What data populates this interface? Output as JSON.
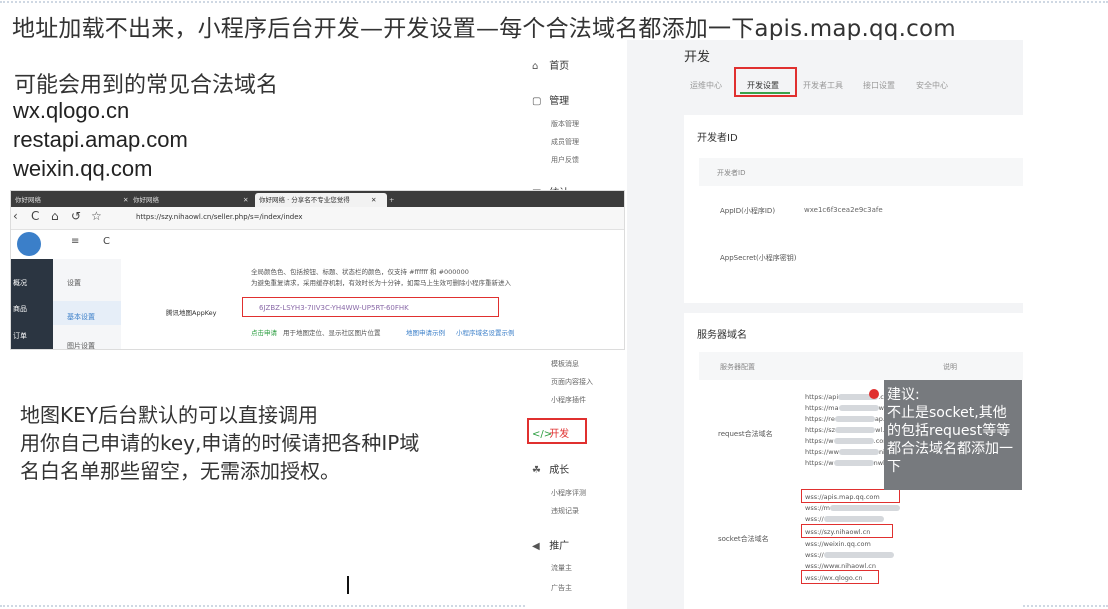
{
  "header": {
    "title": "地址加载不出来，小程序后台开发—开发设置—每个合法域名都添加一下apis.map.qq.com"
  },
  "tips": {
    "heading": "可能会用到的常见合法域名",
    "domains": [
      "wx.qlogo.cn",
      "restapi.amap.com",
      "weixin.qq.com"
    ]
  },
  "key_note": {
    "lines": [
      "地图KEY后台默认的可以直接调用",
      "用你自己申请的key,申请的时候请把各种IP域",
      "名白名单那些留空，无需添加授权。"
    ]
  },
  "advice": {
    "title": "建议:",
    "body": "不止是socket,其他的包括request等等都合法域名都添加一下"
  },
  "wx_admin": {
    "nav": [
      {
        "icon": "⌂",
        "label": "首页"
      },
      {
        "icon": "▢",
        "label": "管理"
      },
      {
        "icon": "▤",
        "label": "统计"
      },
      {
        "icon": "</>",
        "label": "开发"
      },
      {
        "icon": "☘",
        "label": "成长"
      },
      {
        "icon": "◀",
        "label": "推广"
      }
    ],
    "sub_manage": [
      "版本管理",
      "成员管理",
      "用户反馈"
    ],
    "sub_mid": [
      "模板消息",
      "页面内容接入",
      "小程序插件"
    ],
    "sub_grow": [
      "小程序评测",
      "违规记录"
    ],
    "sub_promo": [
      "流量主",
      "广告主"
    ],
    "page_title": "开发",
    "tabs": [
      "运维中心",
      "开发设置",
      "开发者工具",
      "接口设置",
      "安全中心"
    ],
    "dev_id": {
      "heading": "开发者ID",
      "col_header": "开发者ID",
      "appid_label": "AppID(小程序ID)",
      "appid_value": "wxe1c6f3cea2e9c3afe",
      "secret_label": "AppSecret(小程序密钥)"
    },
    "server": {
      "heading": "服务器域名",
      "col_type": "服务器配置",
      "col_note": "说明",
      "request_label": "request合法域名",
      "socket_label": "socket合法域名",
      "request_urls": [
        "https://api",
        "https://ma",
        "https://re",
        "https://sz",
        "https://w",
        "https://ww",
        "https://w"
      ],
      "request_tails": [
        ".com",
        "wl.cn",
        "ap.cn",
        "wl.cn",
        ".com",
        "niu.cn",
        "nwl.cn"
      ],
      "socket_urls": [
        "wss://apis.map.qq.com",
        "wss://m",
        "wss://",
        "wss://szy.nihaowl.cn",
        "wss://weixin.qq.com",
        "wss://",
        "wss://www.nihaowl.cn",
        "wss://wx.qlogo.cn"
      ]
    }
  },
  "browser": {
    "tabs": [
      "你好网络",
      "你好网络",
      "你好网络 · 分享名不专业您觉得"
    ],
    "tab_close": "✕",
    "tab_add": "+",
    "controls": [
      "‹",
      "C",
      "⌂",
      "↺",
      "☆"
    ],
    "url": "https://szy.nihaowl.cn/seller.php/s=/index/index",
    "toolbar_icons": [
      "≡",
      "C"
    ],
    "left_nav": [
      "概况",
      "商品",
      "订单"
    ],
    "left_sub": [
      "设置",
      "基本设置",
      "图片设置"
    ],
    "desc_line1": "全局颜色色、包括按钮、标题、状态栏的颜色，仅支持 #ffffff 和 #000000",
    "desc_line2": "为避免重复请求，采用缓存机制，有效时长为十分钟，如需马上生效可删除小程序重新进入",
    "field_label": "腾讯地图AppKey",
    "field_value": "6JZBZ-LSYH3-7IIV3C-YH4WW-UP5RT-60FHK",
    "link_apply": "点击申请",
    "link_desc": "用于地图定位、显示社区图片位置",
    "link_example1": "地图申请示例",
    "link_example2": "小程序域名设置示例"
  }
}
